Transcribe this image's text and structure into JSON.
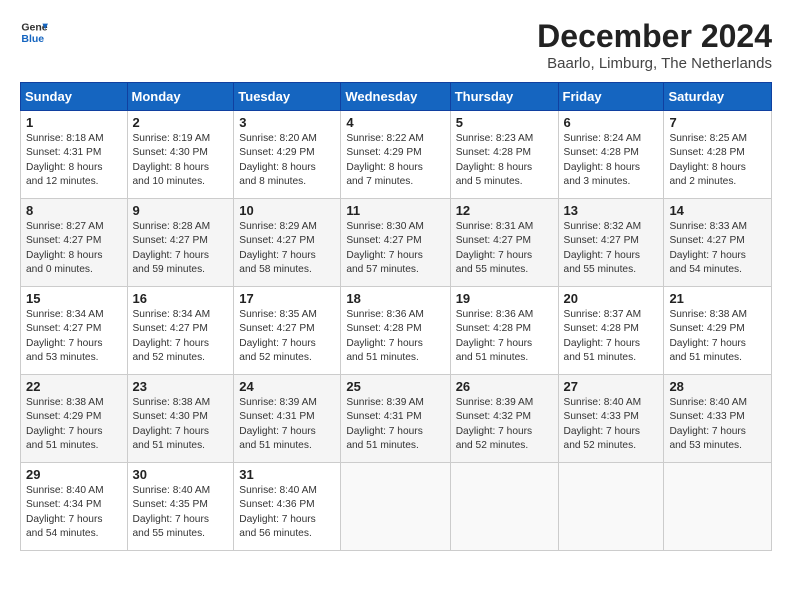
{
  "header": {
    "logo_line1": "General",
    "logo_line2": "Blue",
    "title": "December 2024",
    "subtitle": "Baarlo, Limburg, The Netherlands"
  },
  "days_of_week": [
    "Sunday",
    "Monday",
    "Tuesday",
    "Wednesday",
    "Thursday",
    "Friday",
    "Saturday"
  ],
  "weeks": [
    [
      {
        "num": "1",
        "info": "Sunrise: 8:18 AM\nSunset: 4:31 PM\nDaylight: 8 hours\nand 12 minutes."
      },
      {
        "num": "2",
        "info": "Sunrise: 8:19 AM\nSunset: 4:30 PM\nDaylight: 8 hours\nand 10 minutes."
      },
      {
        "num": "3",
        "info": "Sunrise: 8:20 AM\nSunset: 4:29 PM\nDaylight: 8 hours\nand 8 minutes."
      },
      {
        "num": "4",
        "info": "Sunrise: 8:22 AM\nSunset: 4:29 PM\nDaylight: 8 hours\nand 7 minutes."
      },
      {
        "num": "5",
        "info": "Sunrise: 8:23 AM\nSunset: 4:28 PM\nDaylight: 8 hours\nand 5 minutes."
      },
      {
        "num": "6",
        "info": "Sunrise: 8:24 AM\nSunset: 4:28 PM\nDaylight: 8 hours\nand 3 minutes."
      },
      {
        "num": "7",
        "info": "Sunrise: 8:25 AM\nSunset: 4:28 PM\nDaylight: 8 hours\nand 2 minutes."
      }
    ],
    [
      {
        "num": "8",
        "info": "Sunrise: 8:27 AM\nSunset: 4:27 PM\nDaylight: 8 hours\nand 0 minutes."
      },
      {
        "num": "9",
        "info": "Sunrise: 8:28 AM\nSunset: 4:27 PM\nDaylight: 7 hours\nand 59 minutes."
      },
      {
        "num": "10",
        "info": "Sunrise: 8:29 AM\nSunset: 4:27 PM\nDaylight: 7 hours\nand 58 minutes."
      },
      {
        "num": "11",
        "info": "Sunrise: 8:30 AM\nSunset: 4:27 PM\nDaylight: 7 hours\nand 57 minutes."
      },
      {
        "num": "12",
        "info": "Sunrise: 8:31 AM\nSunset: 4:27 PM\nDaylight: 7 hours\nand 55 minutes."
      },
      {
        "num": "13",
        "info": "Sunrise: 8:32 AM\nSunset: 4:27 PM\nDaylight: 7 hours\nand 55 minutes."
      },
      {
        "num": "14",
        "info": "Sunrise: 8:33 AM\nSunset: 4:27 PM\nDaylight: 7 hours\nand 54 minutes."
      }
    ],
    [
      {
        "num": "15",
        "info": "Sunrise: 8:34 AM\nSunset: 4:27 PM\nDaylight: 7 hours\nand 53 minutes."
      },
      {
        "num": "16",
        "info": "Sunrise: 8:34 AM\nSunset: 4:27 PM\nDaylight: 7 hours\nand 52 minutes."
      },
      {
        "num": "17",
        "info": "Sunrise: 8:35 AM\nSunset: 4:27 PM\nDaylight: 7 hours\nand 52 minutes."
      },
      {
        "num": "18",
        "info": "Sunrise: 8:36 AM\nSunset: 4:28 PM\nDaylight: 7 hours\nand 51 minutes."
      },
      {
        "num": "19",
        "info": "Sunrise: 8:36 AM\nSunset: 4:28 PM\nDaylight: 7 hours\nand 51 minutes."
      },
      {
        "num": "20",
        "info": "Sunrise: 8:37 AM\nSunset: 4:28 PM\nDaylight: 7 hours\nand 51 minutes."
      },
      {
        "num": "21",
        "info": "Sunrise: 8:38 AM\nSunset: 4:29 PM\nDaylight: 7 hours\nand 51 minutes."
      }
    ],
    [
      {
        "num": "22",
        "info": "Sunrise: 8:38 AM\nSunset: 4:29 PM\nDaylight: 7 hours\nand 51 minutes."
      },
      {
        "num": "23",
        "info": "Sunrise: 8:38 AM\nSunset: 4:30 PM\nDaylight: 7 hours\nand 51 minutes."
      },
      {
        "num": "24",
        "info": "Sunrise: 8:39 AM\nSunset: 4:31 PM\nDaylight: 7 hours\nand 51 minutes."
      },
      {
        "num": "25",
        "info": "Sunrise: 8:39 AM\nSunset: 4:31 PM\nDaylight: 7 hours\nand 51 minutes."
      },
      {
        "num": "26",
        "info": "Sunrise: 8:39 AM\nSunset: 4:32 PM\nDaylight: 7 hours\nand 52 minutes."
      },
      {
        "num": "27",
        "info": "Sunrise: 8:40 AM\nSunset: 4:33 PM\nDaylight: 7 hours\nand 52 minutes."
      },
      {
        "num": "28",
        "info": "Sunrise: 8:40 AM\nSunset: 4:33 PM\nDaylight: 7 hours\nand 53 minutes."
      }
    ],
    [
      {
        "num": "29",
        "info": "Sunrise: 8:40 AM\nSunset: 4:34 PM\nDaylight: 7 hours\nand 54 minutes."
      },
      {
        "num": "30",
        "info": "Sunrise: 8:40 AM\nSunset: 4:35 PM\nDaylight: 7 hours\nand 55 minutes."
      },
      {
        "num": "31",
        "info": "Sunrise: 8:40 AM\nSunset: 4:36 PM\nDaylight: 7 hours\nand 56 minutes."
      },
      null,
      null,
      null,
      null
    ]
  ]
}
